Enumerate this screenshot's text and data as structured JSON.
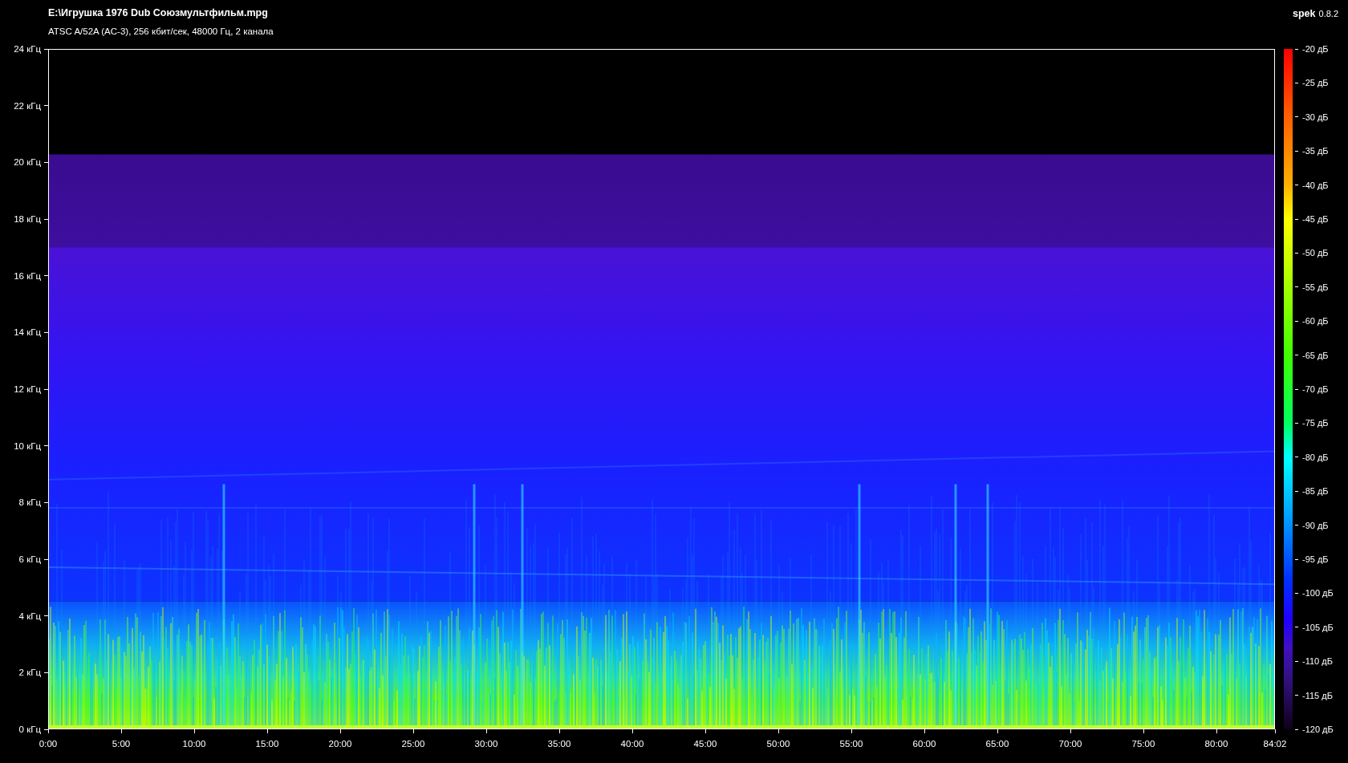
{
  "header": {
    "file_path": "E:\\Игрушка 1976 Dub Союзмультфильм.mpg",
    "stream_info": "ATSC A/52A (AC-3), 256 кбит/сек, 48000 Гц, 2 канала",
    "app_name": "spek",
    "app_version": "0.8.2"
  },
  "frequency_axis": {
    "labels": [
      "24 кГц",
      "22 кГц",
      "20 кГц",
      "18 кГц",
      "16 кГц",
      "14 кГц",
      "12 кГц",
      "10 кГц",
      "8 кГц",
      "6 кГц",
      "4 кГц",
      "2 кГц",
      "0 кГц"
    ]
  },
  "time_axis": {
    "labels": [
      "0:00",
      "5:00",
      "10:00",
      "15:00",
      "20:00",
      "25:00",
      "30:00",
      "35:00",
      "40:00",
      "45:00",
      "50:00",
      "55:00",
      "60:00",
      "65:00",
      "70:00",
      "75:00",
      "80:00",
      "84:02"
    ]
  },
  "color_scale": {
    "labels": [
      "-20 дБ",
      "-25 дБ",
      "-30 дБ",
      "-35 дБ",
      "-40 дБ",
      "-45 дБ",
      "-50 дБ",
      "-55 дБ",
      "-60 дБ",
      "-65 дБ",
      "-70 дБ",
      "-75 дБ",
      "-80 дБ",
      "-85 дБ",
      "-90 дБ",
      "-95 дБ",
      "-100 дБ",
      "-105 дБ",
      "-110 дБ",
      "-115 дБ",
      "-120 дБ"
    ]
  }
}
